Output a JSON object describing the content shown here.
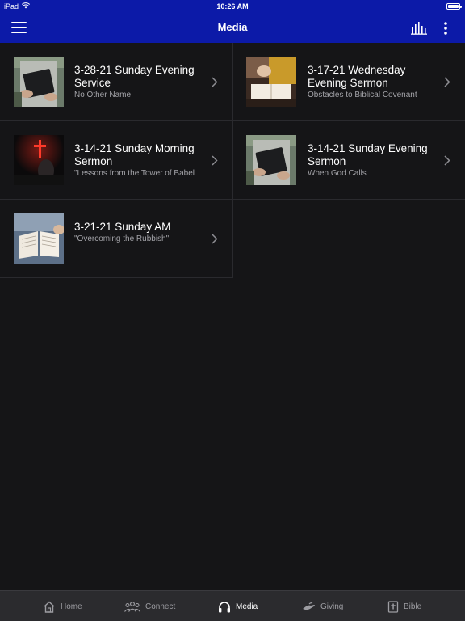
{
  "status_bar": {
    "device": "iPad",
    "time": "10:26 AM"
  },
  "header": {
    "title": "Media"
  },
  "media_items": [
    {
      "title": "3-28-21 Sunday Evening Service",
      "subtitle": "No Other Name",
      "thumb": "man-with-bible"
    },
    {
      "title": "3-17-21 Wednesday Evening Sermon",
      "subtitle": "Obstacles to Biblical Covenant",
      "thumb": "person-reading-bible"
    },
    {
      "title": "3-14-21 Sunday Morning Sermon",
      "subtitle": "\"Lessons from the Tower of Babel",
      "thumb": "red-cross-dark"
    },
    {
      "title": "3-14-21 Sunday Evening Sermon",
      "subtitle": "When God Calls",
      "thumb": "man-with-bible"
    },
    {
      "title": "3-21-21 Sunday AM",
      "subtitle": "\"Overcoming the Rubbish\"",
      "thumb": "open-bible-hand"
    }
  ],
  "tabs": [
    {
      "label": "Home",
      "icon": "home-icon",
      "active": false
    },
    {
      "label": "Connect",
      "icon": "people-icon",
      "active": false
    },
    {
      "label": "Media",
      "icon": "headphones-icon",
      "active": true
    },
    {
      "label": "Giving",
      "icon": "giving-hand-icon",
      "active": false
    },
    {
      "label": "Bible",
      "icon": "bible-icon",
      "active": false
    }
  ],
  "colors": {
    "header_bg": "#0c1aa8",
    "background": "#151517",
    "tab_bar_bg": "#2b2b2e",
    "active_tab": "#ffffff",
    "inactive_tab": "#9d9da2"
  }
}
